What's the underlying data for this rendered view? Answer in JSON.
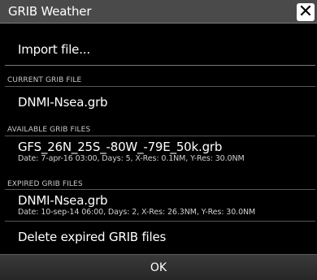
{
  "window": {
    "title": "GRIB Weather",
    "close_glyph": "✕",
    "close_icon": "close-icon"
  },
  "import": {
    "label": "Import file..."
  },
  "current": {
    "section_label": "CURRENT GRIB FILE",
    "file_name": "DNMI-Nsea.grb"
  },
  "available": {
    "section_label": "AVAILABLE GRIB FILES",
    "files": [
      {
        "name": "GFS_26N_25S_-80W_-79E_50k.grb",
        "details": "Date: 7-apr-16 03:00, Days: 5, X-Res: 0.1NM, Y-Res: 30.0NM"
      }
    ]
  },
  "expired": {
    "section_label": "EXPIRED GRIB FILES",
    "files": [
      {
        "name": "DNMI-Nsea.grb",
        "details": "Date: 10-sep-14 06:00, Days: 2, X-Res: 26.3NM, Y-Res: 30.0NM"
      }
    ],
    "delete_label": "Delete expired GRIB files"
  },
  "footer": {
    "ok_label": "OK"
  }
}
